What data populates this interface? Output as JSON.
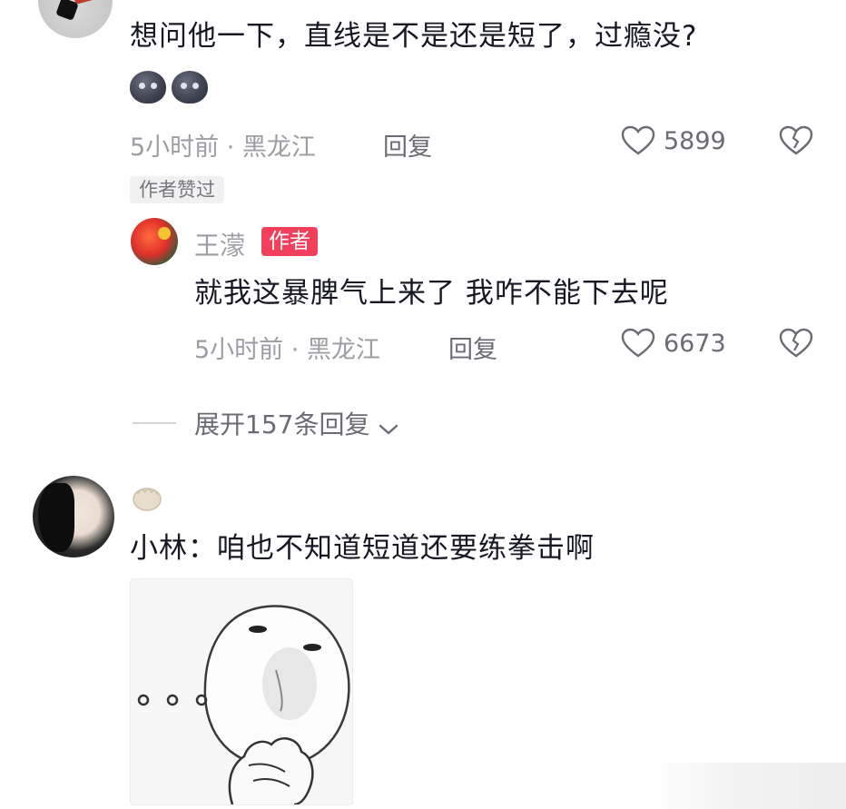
{
  "comment1": {
    "text": "想问他一下，直线是不是还是短了，过瘾没?",
    "emoji": [
      "dark-blob-emoji",
      "dark-blob-emoji"
    ],
    "time_location": "5小时前 · 黑龙江",
    "reply_label": "回复",
    "like_count": "5899",
    "author_liked_badge": "作者赞过"
  },
  "reply1": {
    "username": "王濛",
    "author_tag": "作者",
    "text": "就我这暴脾气上来了 我咋不能下去呢",
    "time_location": "5小时前 · 黑龙江",
    "reply_label": "回复",
    "like_count": "6673"
  },
  "expand": {
    "label": "展开157条回复"
  },
  "comment2": {
    "text": "小林：咱也不知道短道还要练拳击啊",
    "meme_dots": "ooo"
  },
  "colors": {
    "text_primary": "#161823",
    "text_meta": "#9d9da3",
    "author_tag_bg": "#f23f5c"
  }
}
